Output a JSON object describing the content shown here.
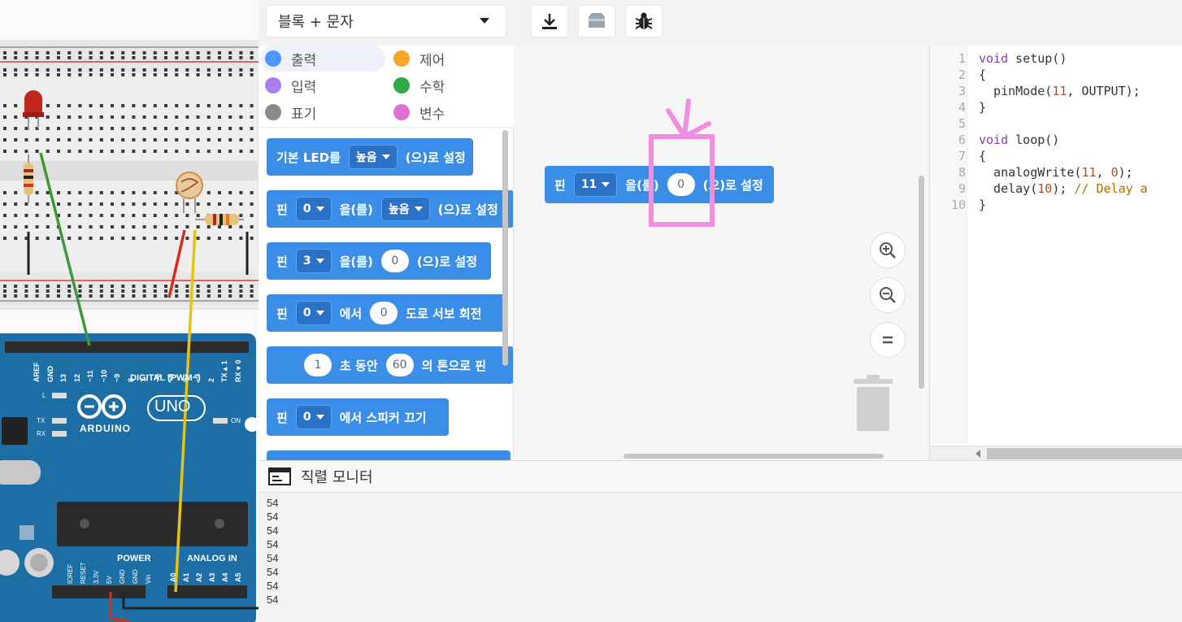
{
  "toolbar": {
    "mode_label": "블록 + 문자",
    "download_icon": "download-icon",
    "components_icon": "component-box-icon",
    "debug_icon": "bug-icon"
  },
  "categories": [
    {
      "label": "출력",
      "color": "#4c97ff",
      "active": true
    },
    {
      "label": "제어",
      "color": "#f5a623"
    },
    {
      "label": "입력",
      "color": "#a97ef0"
    },
    {
      "label": "수학",
      "color": "#2eaa4a"
    },
    {
      "label": "표기",
      "color": "#8a8a8a"
    },
    {
      "label": "변수",
      "color": "#e06fd0"
    }
  ],
  "palette": {
    "b1": {
      "w1": "기본 LED를",
      "dd": "높음",
      "w2": "(으)로 설정"
    },
    "b2": {
      "w1": "핀",
      "dd1": "0",
      "w2": "을(를)",
      "dd2": "높음",
      "w3": "(으)로 설정"
    },
    "b3": {
      "w1": "핀",
      "dd": "3",
      "w2": "을(를)",
      "num": "0",
      "w3": "(으)로 설정"
    },
    "b4": {
      "w1": "핀",
      "dd": "0",
      "w2": "에서",
      "num": "0",
      "w3": "도로 서보 회전"
    },
    "b5": {
      "num1": "1",
      "w1": "초 동안",
      "num2": "60",
      "w2": "의 톤으로 핀"
    },
    "b6": {
      "w1": "핀",
      "dd": "0",
      "w2": "에서 스피커 끄기"
    }
  },
  "workspace": {
    "block": {
      "w1": "핀",
      "dd": "11",
      "w2": "을(를)",
      "num": "0",
      "w3": "(으)로 설정"
    }
  },
  "code": {
    "lines": [
      "void setup()",
      "{",
      "  pinMode(11, OUTPUT);",
      "}",
      "",
      "void loop()",
      "{",
      "  analogWrite(11, 0);",
      "  delay(10); // Delay a",
      "}"
    ],
    "line_numbers": [
      "1",
      "2",
      "3",
      "4",
      "5",
      "6",
      "7",
      "8",
      "9",
      "10"
    ]
  },
  "serial": {
    "title": "직렬 모니터",
    "lines": [
      "54",
      "54",
      "54",
      "54",
      "54",
      "54",
      "54",
      "54"
    ]
  },
  "board": {
    "brand": "ARDUINO",
    "model": "UNO",
    "digital_label": "DIGITAL (PWM~)",
    "power_label": "POWER",
    "analog_label": "ANALOG IN",
    "pins_top": [
      "AREF",
      "GND",
      "13",
      "12",
      "~11",
      "~10",
      "~9",
      "8",
      "7",
      "~6",
      "~5",
      "4",
      "~3",
      "2",
      "TX▸1",
      "RX◂0"
    ],
    "pins_bottom_power": [
      "IOREF",
      "RESET",
      "3.3V",
      "5V",
      "GND",
      "GND",
      "Vin"
    ],
    "pins_bottom_analog": [
      "A0",
      "A1",
      "A2",
      "A3",
      "A4",
      "A5"
    ],
    "led_labels": [
      "L",
      "TX",
      "RX"
    ],
    "on_label": "ON"
  }
}
